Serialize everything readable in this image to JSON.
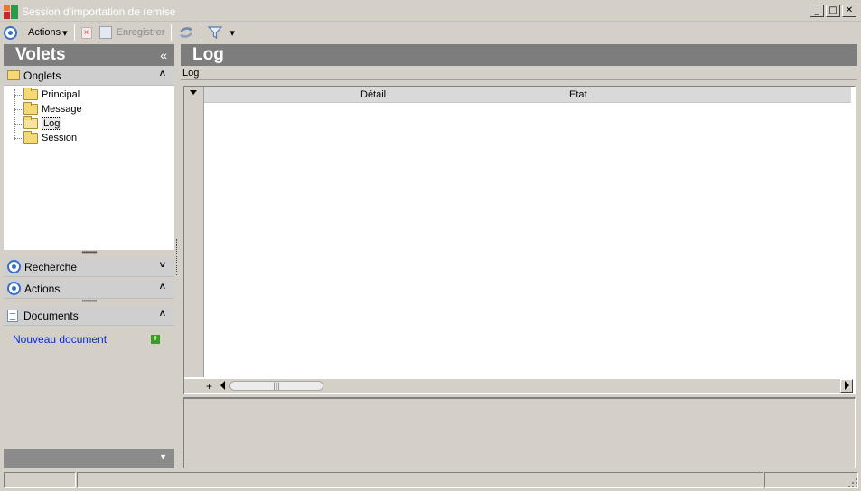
{
  "window": {
    "title": "Session d'importation de remise",
    "minimize_glyph": "_",
    "maximize_glyph": "□",
    "close_glyph": "✕"
  },
  "toolbar": {
    "actions_label": "Actions",
    "save_label": "Enregistrer",
    "dropdown_glyph": "▾"
  },
  "left_pane": {
    "title": "Volets",
    "collapse_glyph": "«",
    "onglets": {
      "label": "Onglets",
      "chevron": "˄",
      "items": [
        {
          "label": "Principal"
        },
        {
          "label": "Message"
        },
        {
          "label": "Log",
          "selected": true
        },
        {
          "label": "Session"
        }
      ]
    },
    "grip": "•••••••••",
    "recherche": {
      "label": "Recherche",
      "chevron": "˅"
    },
    "actions": {
      "label": "Actions",
      "chevron": "˄"
    },
    "documents": {
      "label": "Documents",
      "chevron": "˄",
      "new_doc_label": "Nouveau document",
      "add_glyph": "+"
    },
    "bottom_arrow": "▼"
  },
  "main": {
    "title": "Log",
    "breadcrumb": "Log",
    "grid": {
      "columns": [
        "Détail",
        "Etat"
      ],
      "rows": [],
      "expand_glyph": "+",
      "thumb_glyph": "|||"
    }
  },
  "colors": {
    "header_bg": "#7d7d7d",
    "link": "#0a2ad0",
    "accent_blue": "#3a6ec0"
  }
}
